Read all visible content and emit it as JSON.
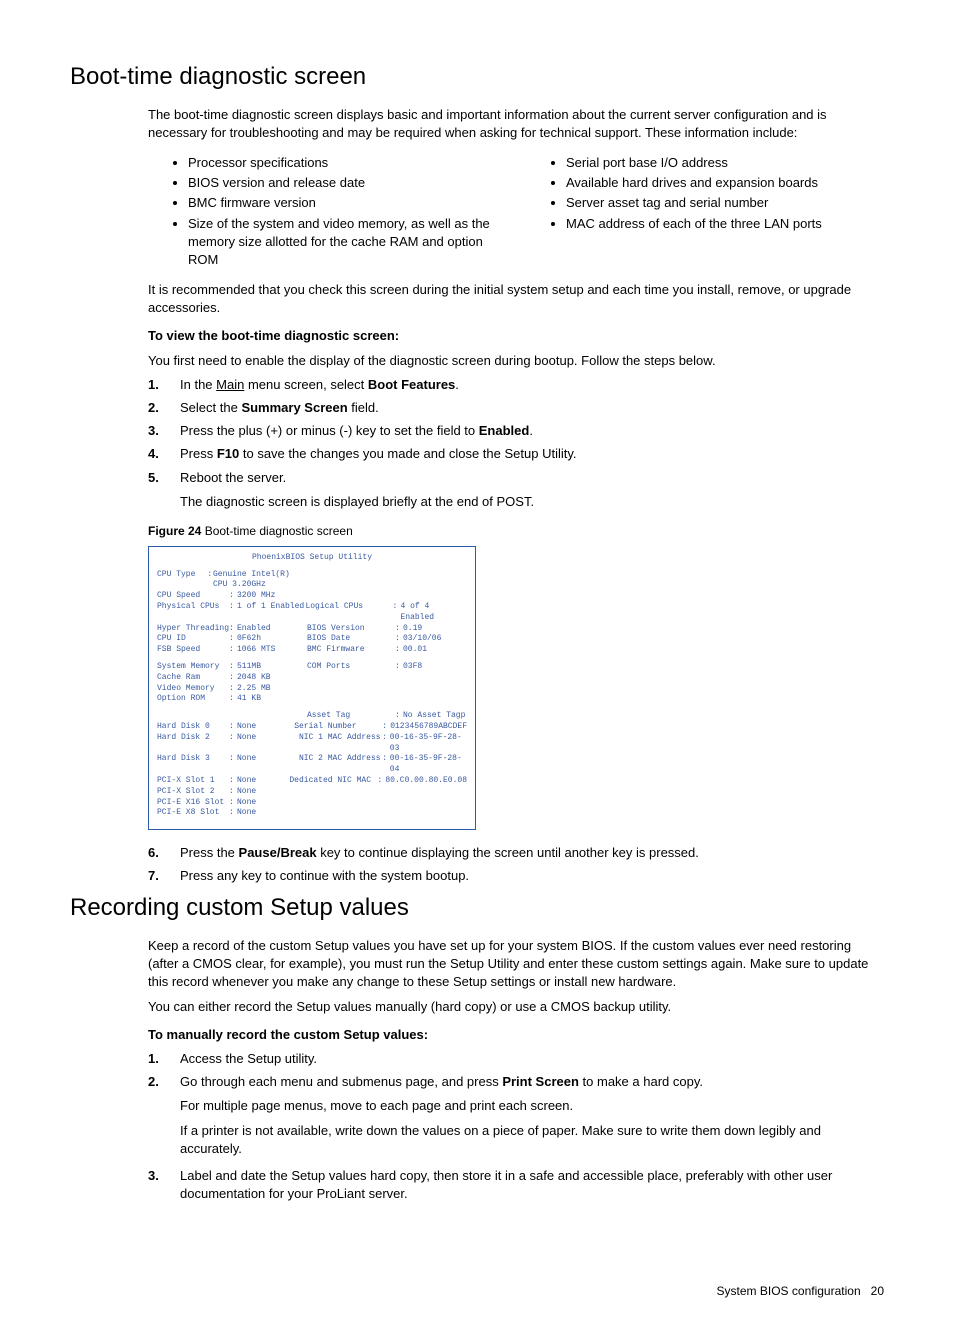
{
  "section1": {
    "heading": "Boot-time diagnostic screen",
    "intro": "The boot-time diagnostic screen displays basic and important information about the current server configuration and is necessary for troubleshooting and may be required when asking for technical support. These information include:",
    "bullets_left": [
      "Processor specifications",
      "BIOS version and release date",
      "BMC firmware version",
      "Size of the system and video memory, as well as the memory size allotted for the cache RAM and option ROM"
    ],
    "bullets_right": [
      "Serial port base I/O address",
      "Available hard drives and expansion boards",
      "Server asset tag and serial number",
      "MAC address of each of the three LAN ports"
    ],
    "after_bullets": "It is recommended that you check this screen during the initial system setup and each time you install, remove, or upgrade accessories.",
    "sub1": "To view the boot-time diagnostic screen:",
    "sub1_intro": "You first need to enable the display of the diagnostic screen during bootup. Follow the steps below.",
    "step1_pre": "In the ",
    "step1_link": "Main",
    "step1_mid": " menu screen, select ",
    "step1_bold": "Boot Features",
    "step1_post": ".",
    "step2_pre": "Select the ",
    "step2_bold": "Summary Screen",
    "step2_post": " field.",
    "step3_pre": "Press the plus (+) or minus (-) key to set the field to ",
    "step3_bold": "Enabled",
    "step3_post": ".",
    "step4_pre": "Press ",
    "step4_bold": "F10",
    "step4_post": " to save the changes you made and close the Setup Utility.",
    "step5": "Reboot the server.",
    "step5_sub": "The diagnostic screen is displayed briefly at the end of POST.",
    "fig_label": "Figure 24",
    "fig_caption": " Boot-time diagnostic screen",
    "step6_pre": "Press the ",
    "step6_bold": "Pause/Break",
    "step6_post": " key to continue displaying the screen until another key is pressed.",
    "step7": "Press any key to continue with the system bootup."
  },
  "bios": {
    "title": "PhoenixBIOS Setup Utility",
    "left_block1": [
      [
        "CPU Type",
        "Genuine Intel(R) CPU 3.20GHz"
      ],
      [
        "CPU Speed",
        "3200 MHz"
      ],
      [
        "Physical CPUs",
        "1 of 1 Enabled"
      ],
      [
        "Hyper Threading",
        "Enabled"
      ],
      [
        "CPU ID",
        "0F62h"
      ],
      [
        "FSB Speed",
        "1066 MTS"
      ]
    ],
    "right_block1": [
      [
        "Logical CPUs",
        "4 of 4 Enabled"
      ],
      [
        "BIOS Version",
        "0.19"
      ],
      [
        "BIOS Date",
        "03/10/06"
      ],
      [
        "BMC Firmware",
        "00.01"
      ]
    ],
    "left_block2": [
      [
        "System Memory",
        "511MB"
      ],
      [
        "Cache Ram",
        "2048 KB"
      ],
      [
        "Video Memory",
        "2.25 MB"
      ],
      [
        "Option ROM",
        "41 KB"
      ]
    ],
    "right_block2": [
      [
        "COM Ports",
        "03F8"
      ]
    ],
    "left_block3": [
      [
        "Hard Disk 0",
        "None"
      ],
      [
        "Hard Disk 2",
        "None"
      ],
      [
        "Hard Disk 3",
        "None"
      ],
      [
        "PCI-X Slot 1",
        "None"
      ],
      [
        "PCI-X Slot 2",
        "None"
      ],
      [
        "PCI-E X16 Slot",
        "None"
      ],
      [
        "PCI-E X8 Slot",
        "None"
      ]
    ],
    "right_block3": [
      [
        "Asset Tag",
        "No Asset Tagp"
      ],
      [
        "Serial Number",
        "0123456789ABCDEF"
      ],
      [
        "NIC 1 MAC Address",
        "00-16-35-9F-28-03"
      ],
      [
        "NIC 2 MAC Address",
        "00-16-35-9F-28-04"
      ],
      [
        "Dedicated NIC MAC",
        "80.C0.00.80.E0.08"
      ]
    ]
  },
  "section2": {
    "heading": "Recording custom Setup values",
    "p1": "Keep a record of the custom Setup values you have set up for your system BIOS. If the custom values ever need restoring (after a CMOS clear, for example), you must run the Setup Utility and enter these custom settings again. Make sure to update this record whenever you make any change to these Setup settings or install new hardware.",
    "p2": "You can either record the Setup values manually (hard copy) or use a CMOS backup utility.",
    "sub": "To manually record the custom Setup values:",
    "s1": "Access the Setup utility.",
    "s2_pre": "Go through each menu and submenus page, and press ",
    "s2_bold": "Print Screen",
    "s2_post": " to make a hard copy.",
    "s2_sub1": "For multiple page menus, move to each page and print each screen.",
    "s2_sub2": "If a printer is not available, write down the values on a piece of paper. Make sure to write them down legibly and accurately.",
    "s3": "Label and date the Setup values hard copy, then store it in a safe and accessible place, preferably with other user documentation for your ProLiant server."
  },
  "footer": {
    "left": "System BIOS configuration",
    "page": "20"
  }
}
